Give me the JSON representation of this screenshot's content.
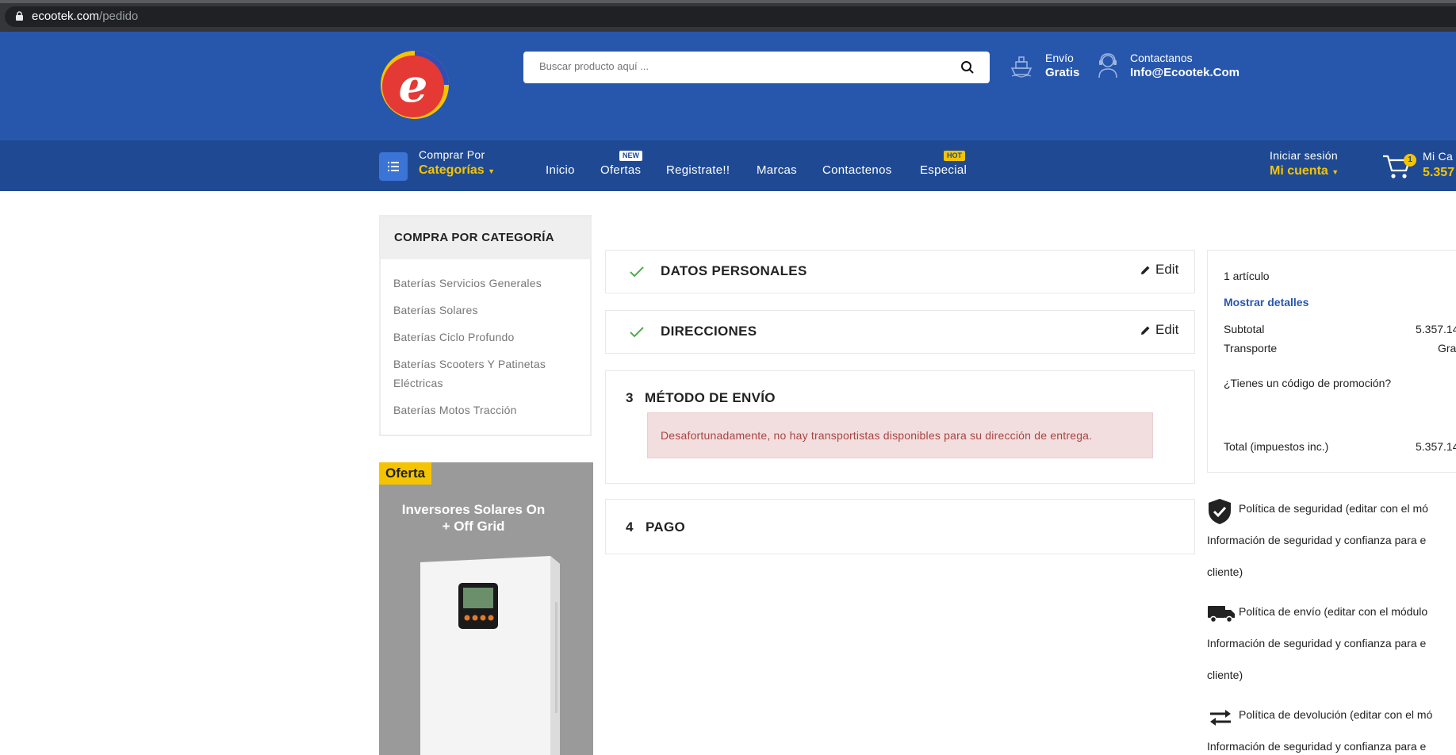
{
  "browser": {
    "url_domain": "ecootek.com",
    "url_path": "/pedido"
  },
  "header": {
    "search_placeholder": "Buscar producto aquí ...",
    "shipping_label": "Envío",
    "shipping_value": "Gratis",
    "contact_label": "Contactanos",
    "contact_value": "Info@Ecootek.Com",
    "brand_colors": {
      "primary": "#2757ac",
      "nav": "#1f4a93",
      "accent": "#f5c400"
    }
  },
  "nav": {
    "shop_by": "Comprar Por",
    "categories": "Categorías",
    "links": [
      "Inicio",
      "Ofertas",
      "Registrate!!",
      "Marcas",
      "Contactenos",
      "Especial"
    ],
    "badge_new": "NEW",
    "badge_hot": "HOT",
    "login": "Iniciar sesión",
    "account": "Mi cuenta",
    "cart_count": "1",
    "cart_label": "Mi Ca",
    "cart_amount": "5.357"
  },
  "sidebar": {
    "title": "COMPRA POR CATEGORÍA",
    "items": [
      "Baterías Servicios Generales",
      "Baterías Solares",
      "Baterías Ciclo Profundo",
      "Baterías Scooters Y Patinetas",
      "Eléctricas",
      "Baterías Motos Tracción"
    ],
    "promo_tag": "Oferta",
    "promo_title_1": "Inversores Solares On",
    "promo_title_2": "+ Off Grid"
  },
  "checkout": {
    "step1_title": "DATOS PERSONALES",
    "step2_title": "DIRECCIONES",
    "edit_label": "Edit",
    "step3_number": "3",
    "step3_title": "MÉTODO DE ENVÍO",
    "step3_alert": "Desafortunadamente, no hay transportistas disponibles para su dirección de entrega.",
    "step4_number": "4",
    "step4_title": "PAGO"
  },
  "summary": {
    "items_count": "1 artículo",
    "show_details": "Mostrar detalles",
    "subtotal_label": "Subtotal",
    "subtotal_value": "5.357.14",
    "shipping_label": "Transporte",
    "shipping_value": "Gra",
    "promo_question": "¿Tienes un código de promoción?",
    "total_label": "Total (impuestos inc.)",
    "total_value": "5.357.14"
  },
  "policies": {
    "security_title": "Política de seguridad (editar con el mó",
    "security_desc_1": "Información de seguridad y confianza para e",
    "security_desc_2": "cliente)",
    "shipping_title": "Política de envío (editar con el módulo",
    "shipping_desc_1": "Información de seguridad y confianza para e",
    "shipping_desc_2": "cliente)",
    "returns_title": "Política de devolución (editar con el mó",
    "returns_desc_1": "Información de seguridad y confianza para e"
  }
}
